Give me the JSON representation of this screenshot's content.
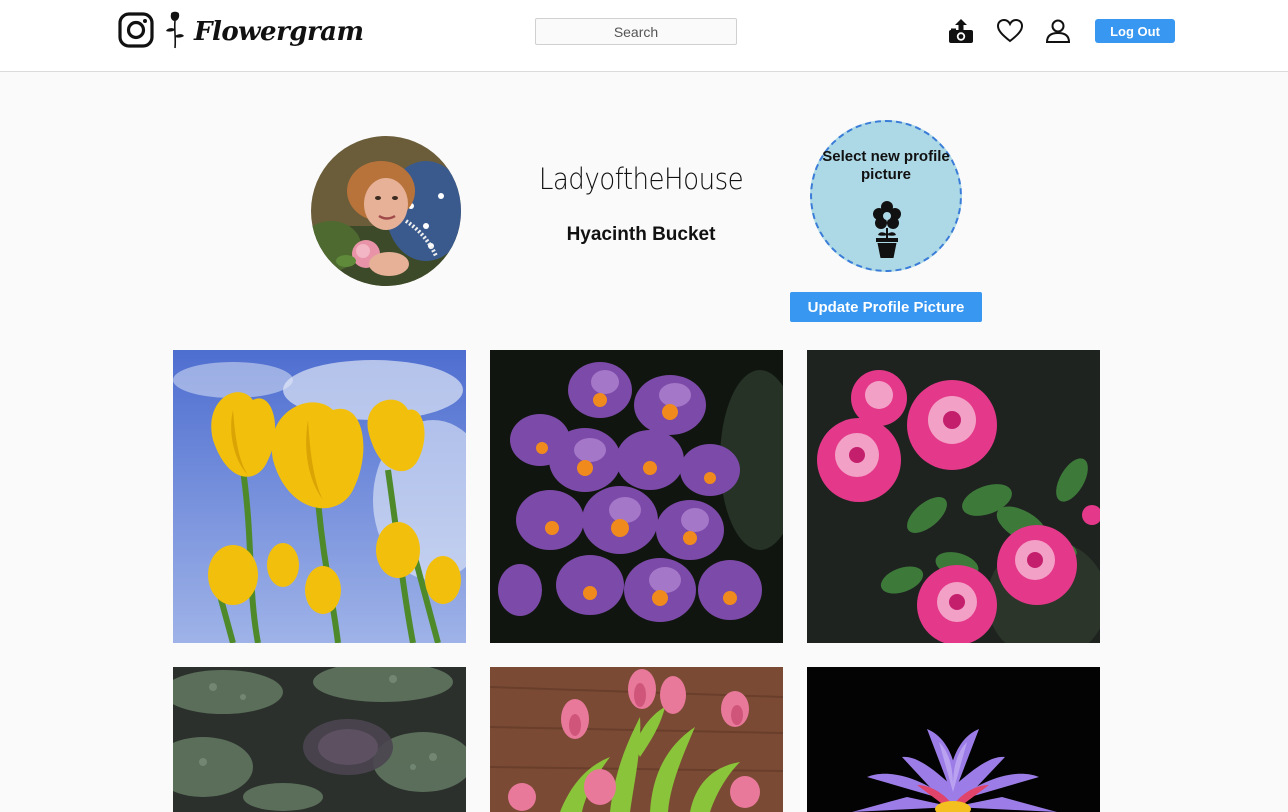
{
  "header": {
    "brand": "Flowergram",
    "search_placeholder": "Search",
    "logout_label": "Log Out",
    "icons": [
      "instagram-logo-icon",
      "rose-logo-icon",
      "camera-upload-icon",
      "heart-icon",
      "user-icon"
    ]
  },
  "profile": {
    "username": "LadyoftheHouse",
    "full_name": "Hyacinth Bucket",
    "select_picture_text": "Select new profile picture",
    "update_button_label": "Update Profile Picture",
    "dropzone_icon": "flowerpot-icon"
  },
  "posts": [
    {
      "subject": "yellow-tulips"
    },
    {
      "subject": "purple-crocuses"
    },
    {
      "subject": "pink-roses"
    },
    {
      "subject": "lily-pads"
    },
    {
      "subject": "pink-tulips"
    },
    {
      "subject": "purple-water-lily"
    }
  ],
  "colors": {
    "accent": "#3897f0",
    "dropzone_fill": "#add8e6",
    "dropzone_border": "#3a7dd8",
    "page_background": "#fafafa"
  }
}
